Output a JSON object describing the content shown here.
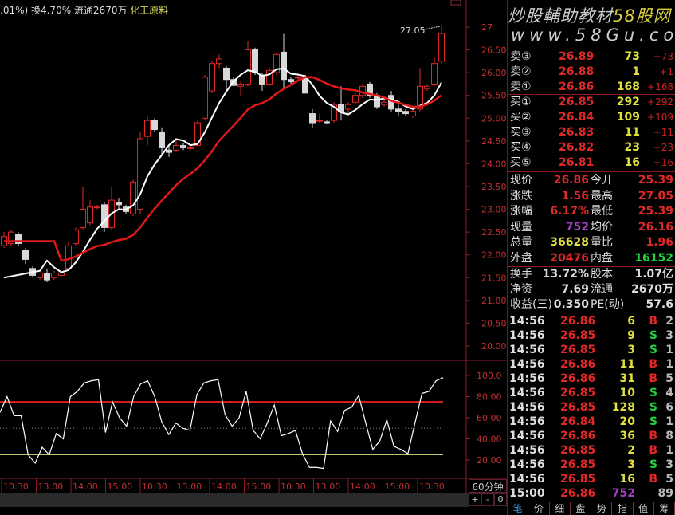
{
  "header": {
    "text": ".01%) 换4.70% 流通2670万",
    "industry": "化工原料"
  },
  "watermark": {
    "line1": "炒股輔助教材",
    "brand": "58股网",
    "line2": "www.58Gu.com"
  },
  "order_book": {
    "asks": [
      {
        "label": "卖③",
        "price": "26.89",
        "vol": "73",
        "chg": "+73"
      },
      {
        "label": "卖②",
        "price": "26.88",
        "vol": "1",
        "chg": "+1"
      },
      {
        "label": "卖①",
        "price": "26.86",
        "vol": "168",
        "chg": "+168"
      }
    ],
    "bids": [
      {
        "label": "买①",
        "price": "26.85",
        "vol": "292",
        "chg": "+292"
      },
      {
        "label": "买②",
        "price": "26.84",
        "vol": "109",
        "chg": "+109"
      },
      {
        "label": "买③",
        "price": "26.83",
        "vol": "11",
        "chg": "+11"
      },
      {
        "label": "买④",
        "price": "26.82",
        "vol": "23",
        "chg": "+23"
      },
      {
        "label": "买⑤",
        "price": "26.81",
        "vol": "16",
        "chg": "+16"
      }
    ]
  },
  "stats": [
    {
      "l1": "现价",
      "v1": "26.86",
      "c1": "#e02828",
      "l2": "今开",
      "v2": "25.39",
      "c2": "#e02828"
    },
    {
      "l1": "涨跌",
      "v1": "1.56",
      "c1": "#e02828",
      "l2": "最高",
      "v2": "27.05",
      "c2": "#e02828"
    },
    {
      "l1": "涨幅",
      "v1": "6.17%",
      "c1": "#e02828",
      "l2": "最低",
      "v2": "25.39",
      "c2": "#e02828"
    },
    {
      "l1": "现量",
      "v1": "752",
      "c1": "#a040c0",
      "l2": "均价",
      "v2": "26.16",
      "c2": "#e02828"
    },
    {
      "l1": "总量",
      "v1": "36628",
      "c1": "#e0e040",
      "l2": "量比",
      "v2": "1.96",
      "c2": "#e02828"
    },
    {
      "l1": "外盘",
      "v1": "20476",
      "c1": "#e02828",
      "l2": "内盘",
      "v2": "16152",
      "c2": "#20d040"
    }
  ],
  "stats2": [
    {
      "l1": "换手",
      "v1": "13.72%",
      "l2": "股本",
      "v2": "1.07亿"
    },
    {
      "l1": "净资",
      "v1": "7.69",
      "l2": "流通",
      "v2": "2670万"
    },
    {
      "l1": "收益(三)",
      "v1": "0.350",
      "l2": "PE(动)",
      "v2": "57.6"
    }
  ],
  "trades": [
    {
      "t": "14:56",
      "p": "26.86",
      "v": "6",
      "bs": "B",
      "n": "2"
    },
    {
      "t": "14:56",
      "p": "26.85",
      "v": "9",
      "bs": "S",
      "n": "3"
    },
    {
      "t": "14:56",
      "p": "26.85",
      "v": "3",
      "bs": "S",
      "n": "1"
    },
    {
      "t": "14:56",
      "p": "26.86",
      "v": "11",
      "bs": "B",
      "n": "1"
    },
    {
      "t": "14:56",
      "p": "26.86",
      "v": "31",
      "bs": "B",
      "n": "5"
    },
    {
      "t": "14:56",
      "p": "26.85",
      "v": "10",
      "bs": "S",
      "n": "4"
    },
    {
      "t": "14:56",
      "p": "26.85",
      "v": "128",
      "bs": "S",
      "n": "6"
    },
    {
      "t": "14:56",
      "p": "26.84",
      "v": "20",
      "bs": "S",
      "n": "1"
    },
    {
      "t": "14:56",
      "p": "26.86",
      "v": "36",
      "bs": "B",
      "n": "8"
    },
    {
      "t": "14:56",
      "p": "26.85",
      "v": "2",
      "bs": "B",
      "n": "1"
    },
    {
      "t": "14:56",
      "p": "26.85",
      "v": "3",
      "bs": "S",
      "n": "3"
    },
    {
      "t": "14:56",
      "p": "26.85",
      "v": "16",
      "bs": "B",
      "n": "5"
    },
    {
      "t": "15:00",
      "p": "26.86",
      "v": "752",
      "bs": "",
      "n": "89"
    }
  ],
  "tabs": [
    "笔",
    "价",
    "细",
    "盘",
    "势",
    "指",
    "值",
    "筹"
  ],
  "period": "60分钟",
  "zoom_controls": [
    "+",
    "-",
    "0"
  ],
  "colors": {
    "up": "#e02828",
    "down": "#d8d8d8",
    "ma1": "#ffffff",
    "ma2": "#e01818"
  },
  "chart_data": [
    {
      "type": "candlestick",
      "title": "60分钟K线",
      "ylim": [
        19.7,
        27.2
      ],
      "yticks": [
        "27",
        "26.50",
        "26.00",
        "25.50",
        "25.00",
        "24.50",
        "24.00",
        "23.50",
        "23.00",
        "22.50",
        "22.00",
        "21.50",
        "21.00",
        "20.50",
        "20.00"
      ],
      "ytick_values": [
        27,
        26.5,
        26,
        25.5,
        25,
        24.5,
        24,
        23.5,
        23,
        22.5,
        22,
        21.5,
        21,
        20.5,
        20
      ],
      "high_label": "27.05",
      "ohlc": [
        [
          22.2,
          22.5,
          22.15,
          22.4
        ],
        [
          22.25,
          22.55,
          22.2,
          22.5
        ],
        [
          22.45,
          22.5,
          22.2,
          22.25
        ],
        [
          22.1,
          22.15,
          21.8,
          21.9
        ],
        [
          21.7,
          21.75,
          21.5,
          21.55
        ],
        [
          21.5,
          21.62,
          21.45,
          21.6
        ],
        [
          21.6,
          21.7,
          21.4,
          21.45
        ],
        [
          21.5,
          21.65,
          21.45,
          21.6
        ],
        [
          21.55,
          21.65,
          21.5,
          21.6
        ],
        [
          21.7,
          22.3,
          21.65,
          22.2
        ],
        [
          22.25,
          22.6,
          22.2,
          22.55
        ],
        [
          22.6,
          23.5,
          22.55,
          23.0
        ],
        [
          22.7,
          23.2,
          22.65,
          23.05
        ],
        [
          23.05,
          23.1,
          23.0,
          23.05
        ],
        [
          23.1,
          23.15,
          22.5,
          22.6
        ],
        [
          22.6,
          23.5,
          22.55,
          23.2
        ],
        [
          23.15,
          23.25,
          23.0,
          23.1
        ],
        [
          23.05,
          23.1,
          22.9,
          22.95
        ],
        [
          22.9,
          23.65,
          22.85,
          23.6
        ],
        [
          23.0,
          24.7,
          22.9,
          24.55
        ],
        [
          24.6,
          25.05,
          24.4,
          24.95
        ],
        [
          24.95,
          25.0,
          24.7,
          24.75
        ],
        [
          24.7,
          24.8,
          24.2,
          24.35
        ],
        [
          24.3,
          24.4,
          24.15,
          24.25
        ],
        [
          24.3,
          24.55,
          24.25,
          24.4
        ],
        [
          24.4,
          24.45,
          24.3,
          24.35
        ],
        [
          24.35,
          24.4,
          24.3,
          24.35
        ],
        [
          24.4,
          24.95,
          24.35,
          24.9
        ],
        [
          25.0,
          25.95,
          24.95,
          25.9
        ],
        [
          25.6,
          26.25,
          25.55,
          26.2
        ],
        [
          26.2,
          26.4,
          26.1,
          26.3
        ],
        [
          26.1,
          26.15,
          25.6,
          25.85
        ],
        [
          25.85,
          25.9,
          25.7,
          25.72
        ],
        [
          25.7,
          25.8,
          25.5,
          25.75
        ],
        [
          25.75,
          26.7,
          25.7,
          26.5
        ],
        [
          26.5,
          26.55,
          25.95,
          26.0
        ],
        [
          25.95,
          26.0,
          25.6,
          25.75
        ],
        [
          25.75,
          26.1,
          25.7,
          26.05
        ],
        [
          26.0,
          26.45,
          25.95,
          26.4
        ],
        [
          26.45,
          26.85,
          25.65,
          25.85
        ],
        [
          25.85,
          25.9,
          25.75,
          25.8
        ],
        [
          25.9,
          25.95,
          25.85,
          25.9
        ],
        [
          25.9,
          25.95,
          25.55,
          25.55
        ],
        [
          25.1,
          25.2,
          24.8,
          24.9
        ],
        [
          24.95,
          25.1,
          24.9,
          24.95
        ],
        [
          24.92,
          24.95,
          24.88,
          24.9
        ],
        [
          24.95,
          25.35,
          24.9,
          25.3
        ],
        [
          25.3,
          25.7,
          24.95,
          25.15
        ],
        [
          25.2,
          25.35,
          25.1,
          25.3
        ],
        [
          25.35,
          25.55,
          25.3,
          25.5
        ],
        [
          25.5,
          25.75,
          25.45,
          25.7
        ],
        [
          25.75,
          25.8,
          25.45,
          25.5
        ],
        [
          25.5,
          25.55,
          25.2,
          25.25
        ],
        [
          25.3,
          25.4,
          25.25,
          25.35
        ],
        [
          25.5,
          25.6,
          25.15,
          25.2
        ],
        [
          25.2,
          25.3,
          25.05,
          25.15
        ],
        [
          25.15,
          25.2,
          25.05,
          25.1
        ],
        [
          25.05,
          25.2,
          25.0,
          25.15
        ],
        [
          25.2,
          26.1,
          25.15,
          25.7
        ],
        [
          25.65,
          25.75,
          25.6,
          25.7
        ],
        [
          25.75,
          26.35,
          25.7,
          26.2
        ],
        [
          26.25,
          27.05,
          26.2,
          26.86
        ]
      ],
      "ma_fast_period": 6,
      "ma_slow_period": 16,
      "xticks": [
        "10:30",
        "13:00",
        "14:00",
        "15:00",
        "10:30",
        "13:00",
        "14:00",
        "15:00",
        "10:30",
        "13:00",
        "14:00",
        "15:00",
        "10:30"
      ]
    },
    {
      "type": "line",
      "title": "oscillator",
      "ylim": [
        10,
        110
      ],
      "yticks": [
        "100.0",
        "80.00",
        "60.00",
        "40.00",
        "20.00"
      ],
      "ytick_values": [
        100,
        80,
        60,
        40,
        20
      ],
      "levels": {
        "upper": 75,
        "middle": 50,
        "lower": 25
      },
      "values": [
        65,
        80,
        62,
        62,
        25,
        17,
        32,
        25,
        45,
        40,
        80,
        85,
        93,
        95,
        96,
        46,
        75,
        60,
        52,
        80,
        92,
        95,
        80,
        56,
        44,
        55,
        50,
        48,
        82,
        93,
        95,
        96,
        63,
        52,
        60,
        85,
        48,
        40,
        55,
        72,
        43,
        45,
        48,
        26,
        13,
        13,
        12,
        57,
        47,
        67,
        70,
        81,
        55,
        30,
        38,
        58,
        33,
        30,
        26,
        55,
        83,
        85,
        95,
        98
      ]
    }
  ]
}
